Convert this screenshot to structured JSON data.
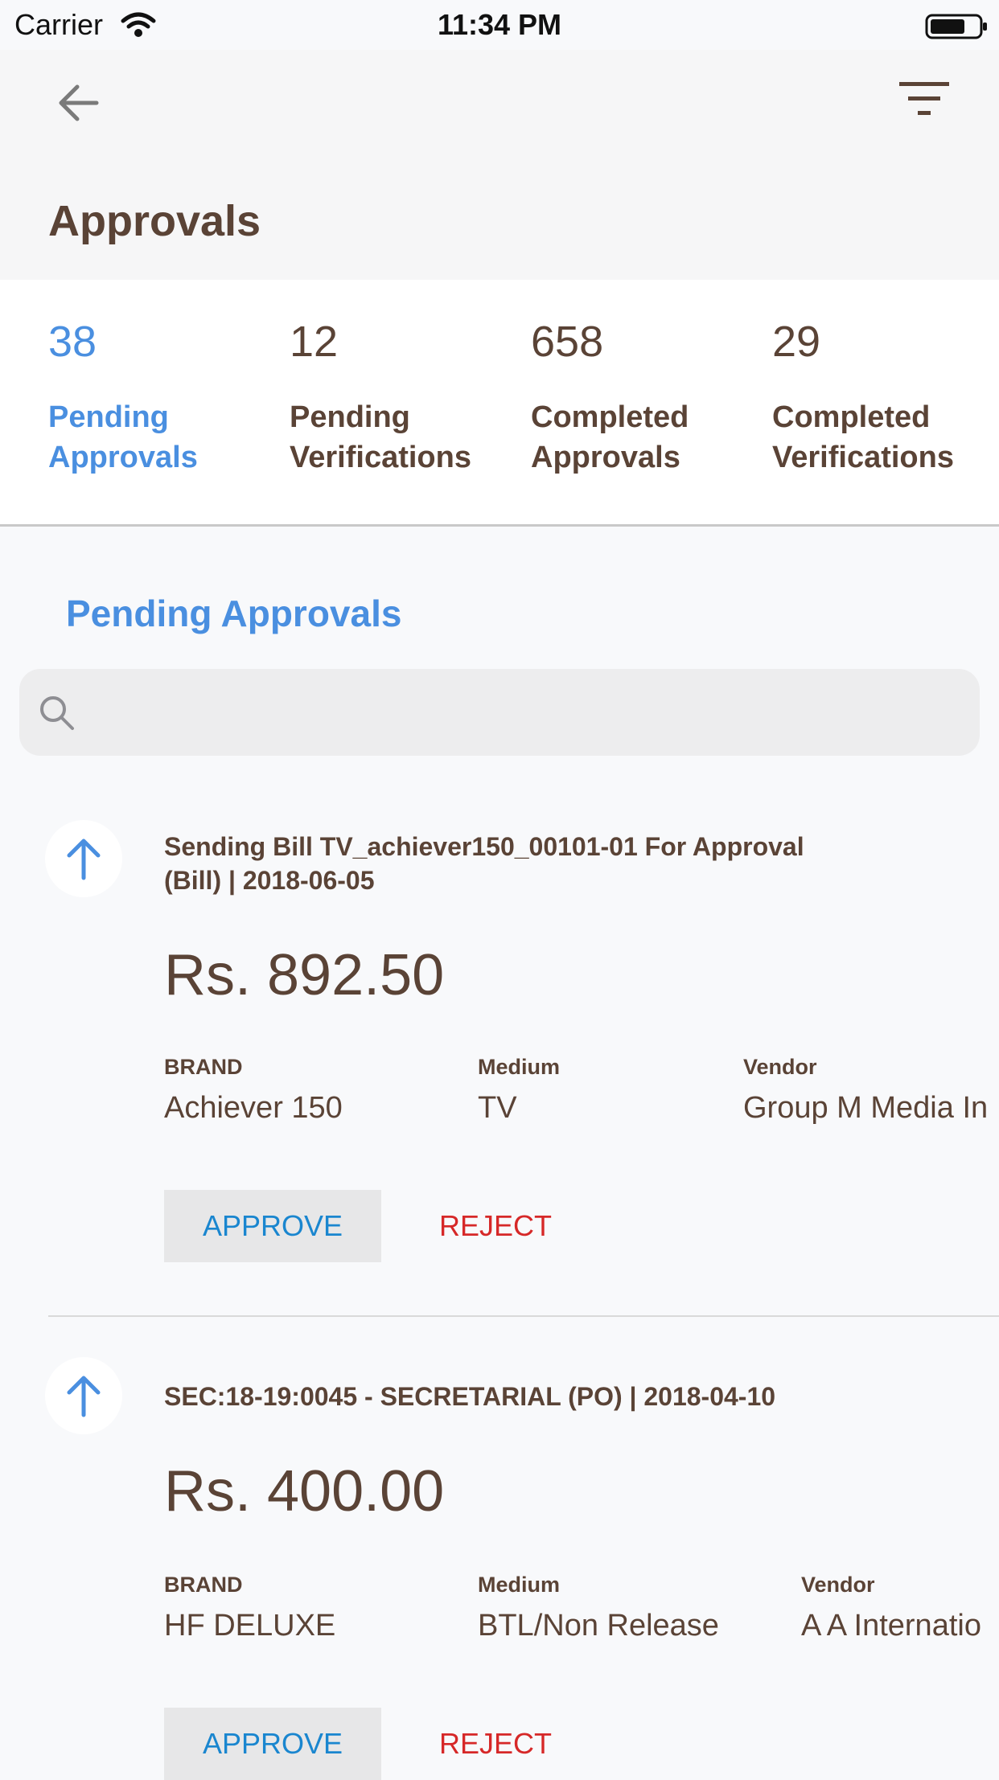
{
  "status_bar": {
    "carrier": "Carrier",
    "time": "11:34 PM"
  },
  "header": {
    "title": "Approvals",
    "back_icon": "arrow-left-icon",
    "filter_icon": "filter-icon"
  },
  "stats": [
    {
      "count": "38",
      "label_line1": "Pending",
      "label_line2": "Approvals",
      "active": true
    },
    {
      "count": "12",
      "label_line1": "Pending",
      "label_line2": "Verifications",
      "active": false
    },
    {
      "count": "658",
      "label_line1": "Completed",
      "label_line2": "Approvals",
      "active": false
    },
    {
      "count": "29",
      "label_line1": "Completed",
      "label_line2": "Verifications",
      "active": false
    }
  ],
  "section": {
    "title": "Pending Approvals"
  },
  "search": {
    "placeholder": "",
    "icon": "search-icon"
  },
  "field_labels": {
    "brand": "BRAND",
    "medium": "Medium",
    "vendor": "Vendor"
  },
  "actions": {
    "approve": "APPROVE",
    "reject": "REJECT"
  },
  "items": [
    {
      "title_line1": "Sending Bill TV_achiever150_00101-01 For Approval",
      "title_line2": "(Bill) | 2018-06-05",
      "amount": "Rs. 892.50",
      "brand": "Achiever 150",
      "medium": "TV",
      "vendor": "Group M Media In"
    },
    {
      "title_line1": "SEC:18-19:0045 - SECRETARIAL (PO) | 2018-04-10",
      "title_line2": "",
      "amount": "Rs. 400.00",
      "brand": "HF DELUXE",
      "medium": "BTL/Non Release",
      "vendor": "A A Internatio"
    }
  ],
  "colors": {
    "accent": "#4a8fe0",
    "text": "#5a4336",
    "reject": "#d62828",
    "approve": "#1a86cf"
  }
}
